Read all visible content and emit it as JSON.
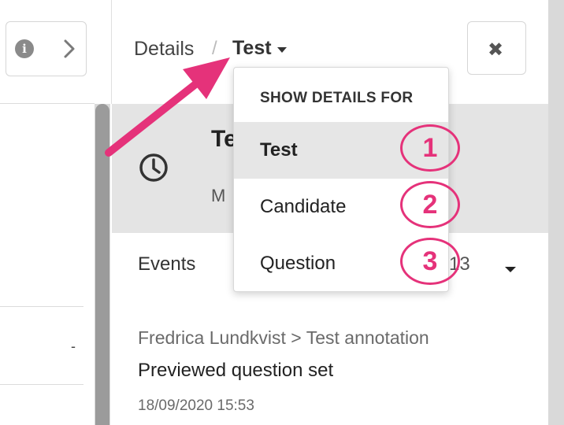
{
  "left": {
    "info_icon": "i",
    "chevron": "chevron-right-icon",
    "dash": "-"
  },
  "breadcrumb": {
    "parent": "Details",
    "separator": "/",
    "current": "Test"
  },
  "close_icon": "✖",
  "card": {
    "title": "Te",
    "subtitle": "M"
  },
  "events": {
    "label": "Events",
    "count": "13"
  },
  "event": {
    "path": "Fredrica Lundkvist > Test annotation",
    "title": "Previewed question set",
    "time": "18/09/2020 15:53"
  },
  "dropdown": {
    "header": "SHOW DETAILS FOR",
    "items": [
      {
        "label": "Test",
        "selected": true
      },
      {
        "label": "Candidate",
        "selected": false
      },
      {
        "label": "Question",
        "selected": false
      }
    ]
  },
  "badges": [
    "1",
    "2",
    "3"
  ],
  "colors": {
    "annotation": "#e5327a",
    "selected_row": "#e6e6e6",
    "scroll_thumb": "#9b9b9b"
  }
}
